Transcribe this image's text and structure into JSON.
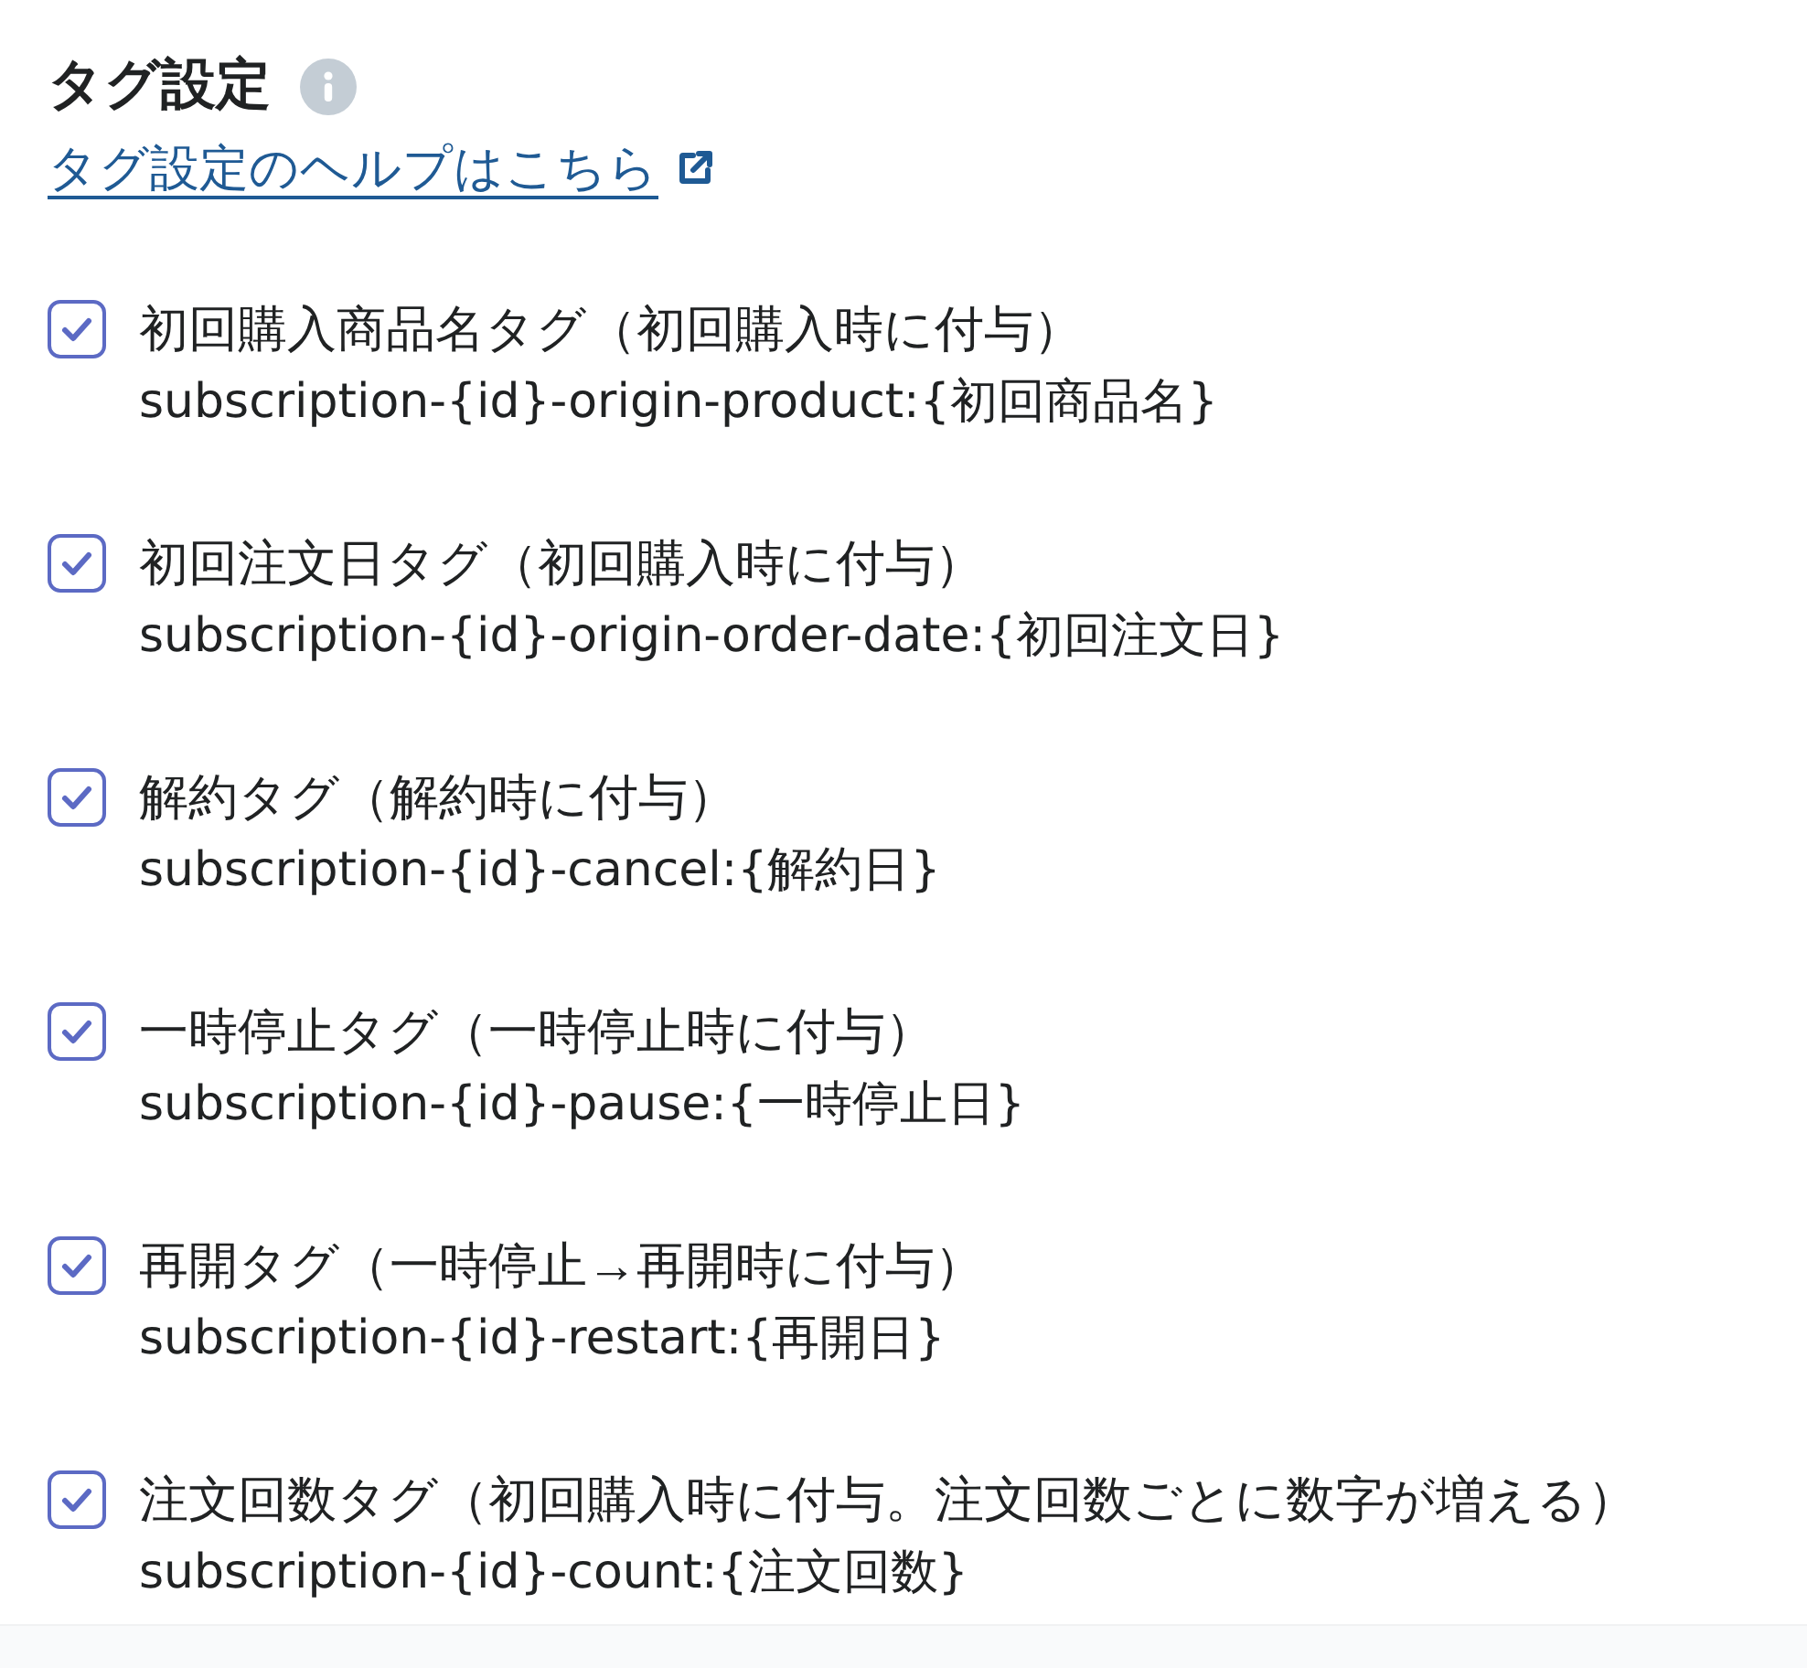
{
  "header": {
    "title": "タグ設定",
    "help_link": "タグ設定のヘルプはこちら"
  },
  "tags": [
    {
      "label": "初回購入商品名タグ（初回購入時に付与）",
      "checked": true,
      "format": "subscription-{id}-origin-product:{初回商品名}"
    },
    {
      "label": "初回注文日タグ（初回購入時に付与）",
      "checked": true,
      "format": "subscription-{id}-origin-order-date:{初回注文日}"
    },
    {
      "label": "解約タグ（解約時に付与）",
      "checked": true,
      "format": "subscription-{id}-cancel:{解約日}"
    },
    {
      "label": "一時停止タグ（一時停止時に付与）",
      "checked": true,
      "format": "subscription-{id}-pause:{一時停止日}"
    },
    {
      "label": "再開タグ（一時停止→再開時に付与）",
      "checked": true,
      "format": "subscription-{id}-restart:{再開日}"
    },
    {
      "label": "注文回数タグ（初回購入時に付与。注文回数ごとに数字が増える）",
      "checked": true,
      "format": "subscription-{id}-count:{注文回数}"
    }
  ]
}
